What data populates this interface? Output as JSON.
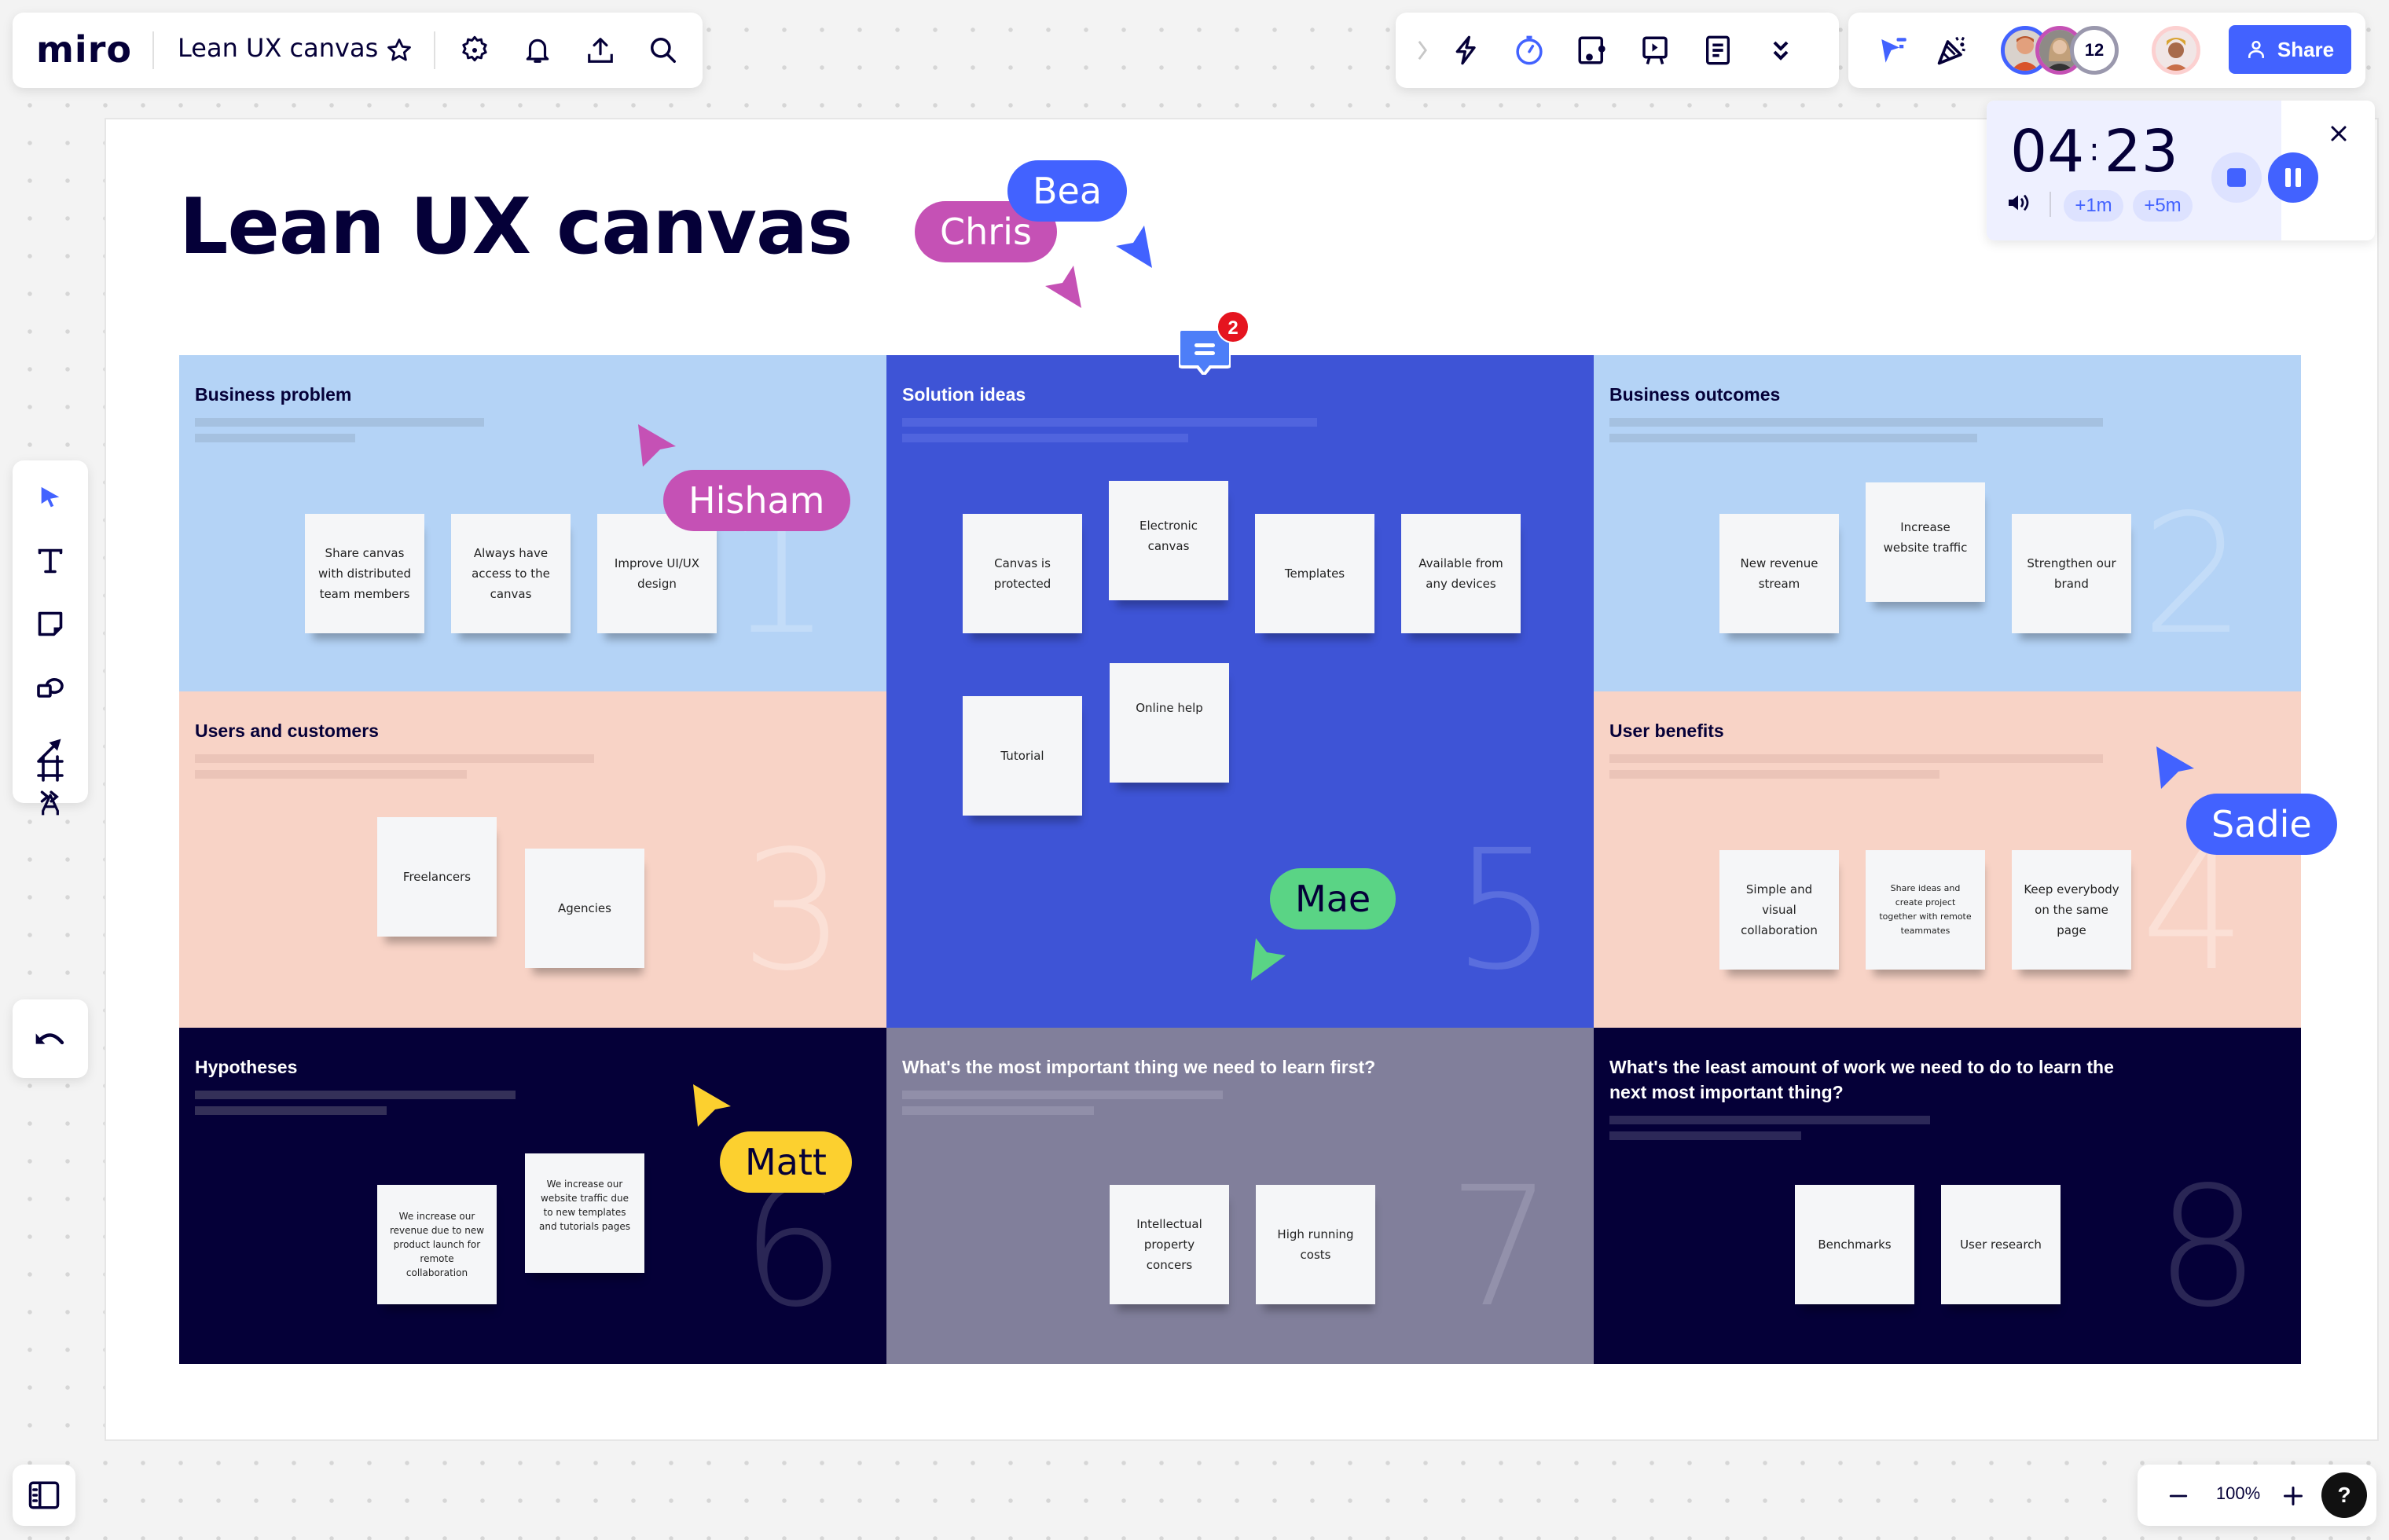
{
  "app": {
    "logo": "miro",
    "board_title": "Lean UX canvas"
  },
  "toolbar_top_left": {
    "icons": [
      "star-icon",
      "settings-icon",
      "bell-icon",
      "upload-icon",
      "search-icon"
    ]
  },
  "toolbar_top_middle": {
    "icons": [
      "chevron-right-icon",
      "lightning-icon",
      "timer-icon",
      "card-icon",
      "presentation-icon",
      "document-icon",
      "double-chevron-down-icon"
    ]
  },
  "collaboration": {
    "extra_collaborators_count": "12",
    "share_label": "Share",
    "colors": {
      "share": "#4262ff"
    }
  },
  "timer": {
    "minutes": "04",
    "separator": ":",
    "seconds": "23",
    "add_1": "+1m",
    "add_5": "+5m",
    "progress_fraction": 0.76
  },
  "canvas": {
    "title": "Lean UX canvas",
    "comment_count": "2",
    "sections": [
      {
        "number": "1",
        "title": "Business problem",
        "stickies": [
          "Share canvas with distributed team members",
          "Always have access to the canvas",
          "Improve UI/UX design"
        ]
      },
      {
        "number": "5",
        "title": "Solution ideas",
        "stickies": [
          "Canvas is protected",
          "Electronic canvas",
          "Templates",
          "Available from any devices",
          "Tutorial",
          "Online help"
        ]
      },
      {
        "number": "2",
        "title": "Business outcomes",
        "stickies": [
          "New revenue stream",
          "Increase website traffic",
          "Strengthen our brand"
        ]
      },
      {
        "number": "3",
        "title": "Users and customers",
        "stickies": [
          "Freelancers",
          "Agencies"
        ]
      },
      {
        "number": "4",
        "title": "User benefits",
        "stickies": [
          "Simple and visual collaboration",
          "Share ideas and create project together with remote teammates",
          "Keep everybody on the same page"
        ]
      },
      {
        "number": "6",
        "title": "Hypotheses",
        "stickies": [
          "We increase our revenue due to new product launch for remote collaboration",
          "We increase our website traffic due to new templates and tutorials pages"
        ]
      },
      {
        "number": "7",
        "title": "What's the most important thing we need to learn first?",
        "stickies": [
          "Intellectual property concers",
          "High running costs"
        ]
      },
      {
        "number": "8",
        "title": "What's the least amount of work we need to do to learn the next most important thing?",
        "stickies": [
          "Benchmarks",
          "User research"
        ]
      }
    ],
    "section_colors": {
      "light_blue": "#b4d3f6",
      "blue": "#3e54d6",
      "peach": "#f8d3c6",
      "navy": "#050038",
      "gray": "#817f9b"
    }
  },
  "cursors": [
    {
      "name": "Bea",
      "color": "#4262ff"
    },
    {
      "name": "Chris",
      "color": "#c551b5"
    },
    {
      "name": "Hisham",
      "color": "#c551b5"
    },
    {
      "name": "Sadie",
      "color": "#4262ff"
    },
    {
      "name": "Mae",
      "color": "#5ad485"
    },
    {
      "name": "Matt",
      "color": "#fcd02f"
    }
  ],
  "left_toolbar": {
    "tools": [
      "select-icon",
      "text-icon",
      "sticky-note-icon",
      "shapes-icon",
      "arrow-icon",
      "pen-icon",
      "frame-icon",
      "more-tools-icon"
    ],
    "undo": "undo-icon"
  },
  "zoom": {
    "level": "100%",
    "help": "?"
  }
}
